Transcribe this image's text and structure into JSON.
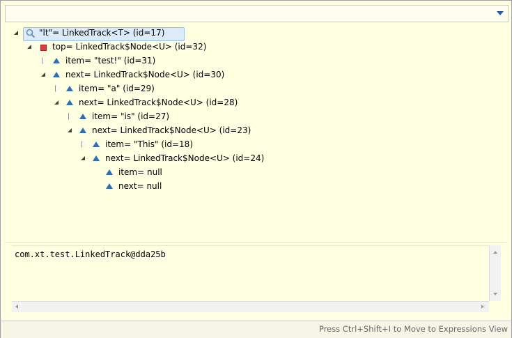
{
  "tree": {
    "nodes": [
      {
        "label": "\"lt\"= LinkedTrack<T>  (id=17)"
      },
      {
        "label": "top= LinkedTrack$Node<U>  (id=32)"
      },
      {
        "label": "item= \"test!\" (id=31)"
      },
      {
        "label": "next= LinkedTrack$Node<U>  (id=30)"
      },
      {
        "label": "item= \"a\" (id=29)"
      },
      {
        "label": "next= LinkedTrack$Node<U>  (id=28)"
      },
      {
        "label": "item= \"is\" (id=27)"
      },
      {
        "label": "next= LinkedTrack$Node<U>  (id=23)"
      },
      {
        "label": "item= \"This\" (id=18)"
      },
      {
        "label": "next= LinkedTrack$Node<U>  (id=24)"
      },
      {
        "label": "item= null"
      },
      {
        "label": "next= null"
      }
    ]
  },
  "detail": {
    "value": "com.xt.test.LinkedTrack@dda25b"
  },
  "status": {
    "hint": "Press Ctrl+Shift+I to Move to Expressions View"
  },
  "icons": {
    "field": "blue-triangle-icon",
    "private_field": "red-square-icon",
    "expression": "search-icon",
    "view_menu": "chevron-down-icon"
  },
  "colors": {
    "background": "#ffffe1",
    "selection": "#dcebf9",
    "field_icon": "#2f6fba",
    "private_icon": "#d94040"
  }
}
